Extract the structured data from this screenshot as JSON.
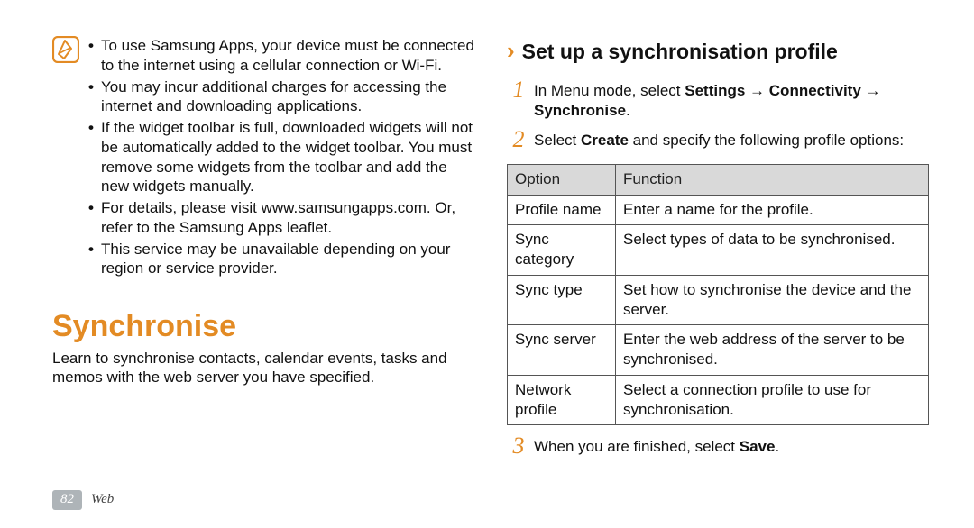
{
  "left": {
    "notes": [
      "To use Samsung Apps, your device must be connected to the internet using a cellular connection or Wi-Fi.",
      "You may incur additional charges for accessing the internet and downloading applications.",
      "If the widget toolbar is full, downloaded widgets will not be automatically added to the widget toolbar. You must remove some widgets from the toolbar and add the new widgets manually.",
      "For details, please visit www.samsungapps.com. Or, refer to the Samsung Apps leaflet.",
      "This service may be unavailable depending on your region or service provider."
    ],
    "heading": "Synchronise",
    "body": "Learn to synchronise contacts, calendar events, tasks and memos with the web server you have specified."
  },
  "right": {
    "chevron": "›",
    "sub_heading": "Set up a synchronisation profile",
    "step1_num": "1",
    "step1_pre": "In Menu mode, select ",
    "step1_b1": "Settings",
    "step1_arr1": " → ",
    "step1_b2": "Connectivity",
    "step1_arr2": " → ",
    "step1_b3": "Synchronise",
    "step1_post": ".",
    "step2_num": "2",
    "step2_pre": "Select ",
    "step2_b": "Create",
    "step2_post": " and specify the following profile options:",
    "table": {
      "h1": "Option",
      "h2": "Function",
      "rows": [
        {
          "c1": "Profile name",
          "c2": "Enter a name for the profile."
        },
        {
          "c1": "Sync category",
          "c2": "Select types of data to be synchronised."
        },
        {
          "c1": "Sync type",
          "c2": "Set how to synchronise the device and the server."
        },
        {
          "c1": "Sync server",
          "c2": "Enter the web address of the server to be synchronised."
        },
        {
          "c1": "Network profile",
          "c2": "Select a connection profile to use for synchronisation."
        }
      ]
    },
    "step3_num": "3",
    "step3_pre": "When you are finished, select ",
    "step3_b": "Save",
    "step3_post": "."
  },
  "footer": {
    "page": "82",
    "section": "Web"
  }
}
